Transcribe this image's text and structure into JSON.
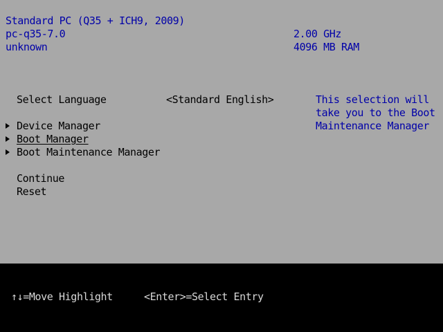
{
  "system_info": {
    "platform": "Standard PC (Q35 + ICH9, 2009)",
    "machine": "pc-q35-7.0",
    "version": "unknown",
    "cpu_speed": "2.00 GHz",
    "memory": "4096 MB RAM"
  },
  "menu": {
    "language_label": "Select Language",
    "language_value": "<Standard English>",
    "items": [
      {
        "label": "Device Manager"
      },
      {
        "label": "Boot Manager"
      },
      {
        "label": "Boot Maintenance Manager"
      }
    ],
    "continue_label": "Continue",
    "reset_label": "Reset"
  },
  "help_text": [
    "This selection will",
    "take you to the Boot",
    "Maintenance Manager"
  ],
  "footer": {
    "move_hint": "↑↓=Move Highlight",
    "select_hint": "<Enter>=Select Entry"
  },
  "colors": {
    "background": "#a8a8a8",
    "header_text": "#0000a8",
    "footer_bg": "#000000"
  }
}
